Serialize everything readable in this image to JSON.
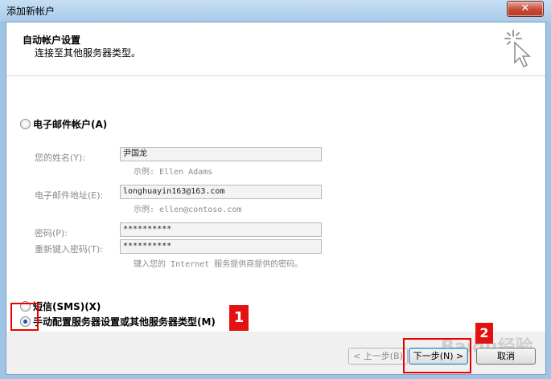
{
  "window": {
    "title": "添加新帐户",
    "close_glyph": "✕"
  },
  "header": {
    "title": "自动帐户设置",
    "subtitle": "连接至其他服务器类型。"
  },
  "email_option": {
    "label": "电子邮件帐户(A)",
    "name_label": "您的姓名(Y):",
    "name_value": "尹国龙",
    "name_hint": "示例: Ellen Adams",
    "email_label": "电子邮件地址(E):",
    "email_value": "longhuayin163@163.com",
    "email_hint": "示例: ellen@contoso.com",
    "password_label": "密码(P):",
    "password_value": "**********",
    "retype_label": "重新键入密码(T):",
    "retype_value": "**********",
    "password_hint": "键入您的 Internet 服务提供商提供的密码。"
  },
  "sms_option": {
    "label": "短信(SMS)(X)"
  },
  "manual_option": {
    "label": "手动配置服务器设置或其他服务器类型(M)",
    "selected": true
  },
  "annotations": {
    "badge1": "1",
    "badge2": "2"
  },
  "buttons": {
    "back": "< 上一步(B)",
    "next": "下一步(N) >",
    "cancel": "取消"
  },
  "watermark": "Baidu经验"
}
